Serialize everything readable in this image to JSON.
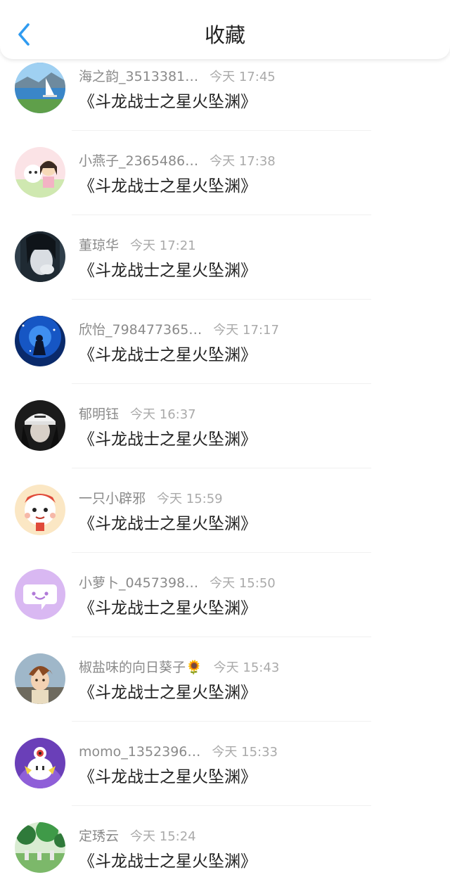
{
  "header": {
    "title": "收藏",
    "back_icon": "chevron-left-icon",
    "accent_color": "#2f9bf0"
  },
  "items": [
    {
      "username": "海之韵_3513381…",
      "time": "今天 17:45",
      "title": "《斗龙战士之星火坠渊》",
      "avatar": "lake-sailboat"
    },
    {
      "username": "小燕子_2365486…",
      "time": "今天 17:38",
      "title": "《斗龙战士之星火坠渊》",
      "avatar": "anime-girl-dog"
    },
    {
      "username": "董琼华",
      "time": "今天 17:21",
      "title": "《斗龙战士之星火坠渊》",
      "avatar": "girl-dark-hair"
    },
    {
      "username": "欣怡_798477365…",
      "time": "今天 17:17",
      "title": "《斗龙战士之星火坠渊》",
      "avatar": "blue-starry-night"
    },
    {
      "username": "郁明钰",
      "time": "今天 16:37",
      "title": "《斗龙战士之星火坠渊》",
      "avatar": "girl-white-cap"
    },
    {
      "username": "一只小辟邪",
      "time": "今天 15:59",
      "title": "《斗龙战士之星火坠渊》",
      "avatar": "cartoon-pixiu"
    },
    {
      "username": "小萝卜_0457398…",
      "time": "今天 15:50",
      "title": "《斗龙战士之星火坠渊》",
      "avatar": "purple-chat-bubble"
    },
    {
      "username": "椒盐味的向日葵子🌻",
      "time": "今天 15:43",
      "title": "《斗龙战士之星火坠渊》",
      "avatar": "anime-boy-brown-hair"
    },
    {
      "username": "momo_1352396…",
      "time": "今天 15:33",
      "title": "《斗龙战士之星火坠渊》",
      "avatar": "purple-cartoon-creature"
    },
    {
      "username": "定琇云",
      "time": "今天 15:24",
      "title": "《斗龙战士之星火坠渊》",
      "avatar": "green-garden"
    }
  ]
}
